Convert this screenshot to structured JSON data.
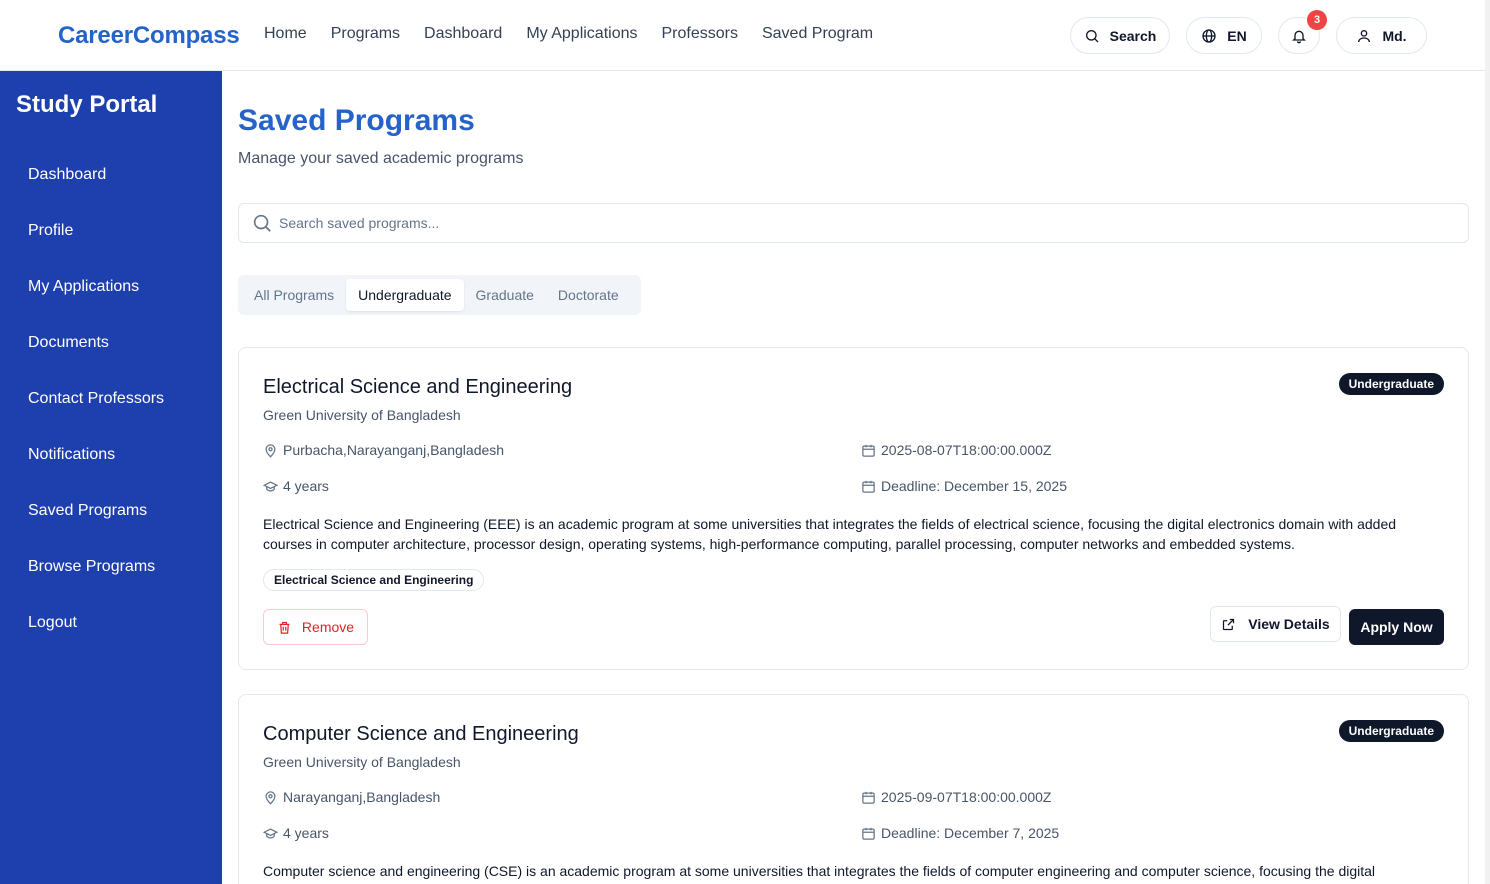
{
  "brand": "CareerCompass",
  "nav": [
    "Home",
    "Programs",
    "Dashboard",
    "My Applications",
    "Professors",
    "Saved Program"
  ],
  "header": {
    "search_label": "Search",
    "language": "EN",
    "notification_count": "3",
    "user_label": "Md."
  },
  "sidebar": {
    "title": "Study Portal",
    "items": [
      "Dashboard",
      "Profile",
      "My Applications",
      "Documents",
      "Contact Professors",
      "Notifications",
      "Saved Programs",
      "Browse Programs",
      "Logout"
    ]
  },
  "main": {
    "title": "Saved Programs",
    "subtitle": "Manage your saved academic programs",
    "search_placeholder": "Search saved programs...",
    "tabs": [
      "All Programs",
      "Undergraduate",
      "Graduate",
      "Doctorate"
    ],
    "active_tab": "Undergraduate"
  },
  "programs": [
    {
      "title": "Electrical Science and Engineering",
      "university": "Green University of Bangladesh",
      "level": "Undergraduate",
      "location": "Purbacha,Narayanganj,Bangladesh",
      "date": "2025-08-07T18:00:00.000Z",
      "duration": "4 years",
      "deadline": "Deadline: December 15, 2025",
      "description": "Electrical Science and Engineering (EEE) is an academic program at some universities that integrates the fields of electrical science, focusing the digital electronics domain with added courses in computer architecture, processor design, operating systems, high-performance computing, parallel processing, computer networks and embedded systems.",
      "tag": "Electrical Science and Engineering",
      "remove_label": "Remove",
      "view_label": "View Details",
      "apply_label": "Apply Now"
    },
    {
      "title": "Computer Science and Engineering",
      "university": "Green University of Bangladesh",
      "level": "Undergraduate",
      "location": "Narayanganj,Bangladesh",
      "date": "2025-09-07T18:00:00.000Z",
      "duration": "4 years",
      "deadline": "Deadline: December 7, 2025",
      "description": "Computer science and engineering (CSE) is an academic program at some universities that integrates the fields of computer engineering and computer science, focusing the digital electronics"
    }
  ],
  "colors": {
    "brand": "#2563c9",
    "sidebar": "#1e3fae",
    "dark": "#0f172a",
    "danger": "#dc2626",
    "badge": "#ef4444"
  }
}
